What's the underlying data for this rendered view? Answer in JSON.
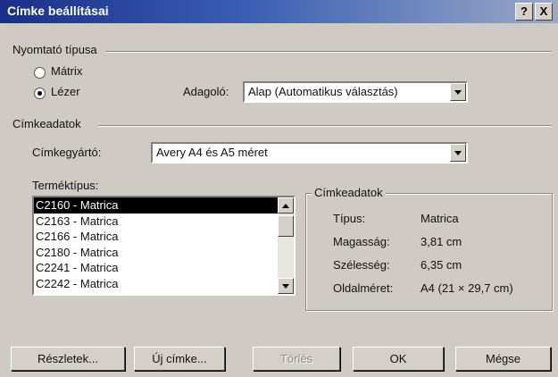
{
  "window": {
    "title": "Címke beállításai",
    "help_btn": "?",
    "close_btn": "X"
  },
  "printer": {
    "group_label": "Nyomtató típusa",
    "matrix_label": "Mátrix",
    "laser_label": "Lézer",
    "selected": "laser",
    "feeder_label": "Adagoló:",
    "feeder_value": "Alap (Automatikus választás)"
  },
  "label_data": {
    "group_label": "Címkeadatok",
    "vendor_label": "Címkegyártó:",
    "vendor_value": "Avery A4 és A5 méret",
    "product_label": "Terméktípus:",
    "products": [
      "C2160 - Matrica",
      "C2163 - Matrica",
      "C2166 - Matrica",
      "C2180 - Matrica",
      "C2241 - Matrica",
      "C2242 - Matrica"
    ],
    "selected_index": 0
  },
  "info": {
    "legend": "Címkeadatok",
    "type_label": "Típus:",
    "type_value": "Matrica",
    "height_label": "Magasság:",
    "height_value": "3,81 cm",
    "width_label": "Szélesség:",
    "width_value": "6,35 cm",
    "page_label": "Oldalméret:",
    "page_value": "A4 (21 × 29,7 cm)"
  },
  "buttons": {
    "details": "Részletek...",
    "new_label": "Új címke...",
    "delete": "Törlés",
    "ok": "OK",
    "cancel": "Mégse"
  }
}
